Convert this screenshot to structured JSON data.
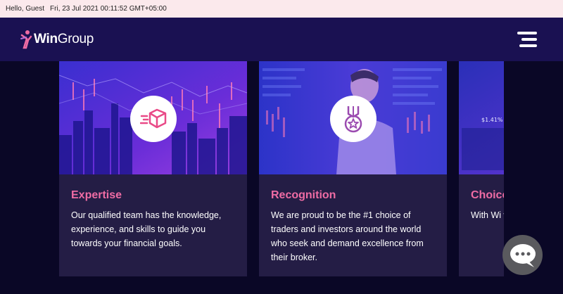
{
  "topbar": {
    "greeting": "Hello, Guest",
    "datetime": "Fri, 23 Jul 2021 00:11:52 GMT+05:00"
  },
  "nav": {
    "logo_bold": "Win",
    "logo_rest": "Group",
    "menu_icon": "hamburger-menu-icon"
  },
  "cards": [
    {
      "title": "Expertise",
      "text": "Our qualified team has the knowledge, experience, and skills to guide you towards your financial goals.",
      "icon": "fast-box-icon"
    },
    {
      "title": "Recognition",
      "text": "We are proud to be the #1 choice of traders and investors around the world who seek and demand excellence from their broker.",
      "icon": "medal-icon"
    },
    {
      "title": "Choice",
      "text": "With Wi widest c trading, more.",
      "icon": ""
    }
  ],
  "chat": {
    "icon": "chat-bubble-icon"
  },
  "colors": {
    "accent": "#ef6ca4",
    "nav_bg": "#1a1152",
    "card_bg": "#241d45",
    "page_bg": "#0a0726"
  }
}
